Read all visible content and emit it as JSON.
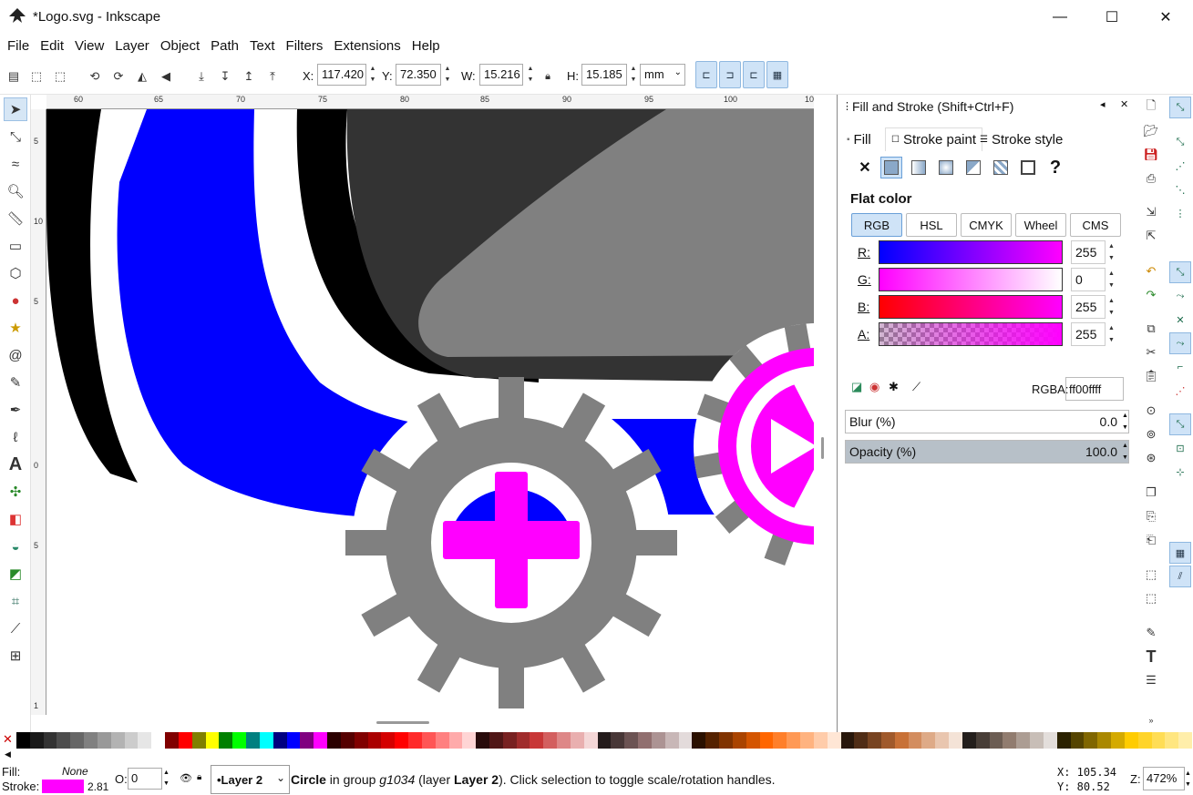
{
  "window": {
    "title": "*Logo.svg - Inkscape",
    "controls": {
      "minimize": "—",
      "maximize": "☐",
      "close": "✕"
    }
  },
  "menu": [
    "File",
    "Edit",
    "View",
    "Layer",
    "Object",
    "Path",
    "Text",
    "Filters",
    "Extensions",
    "Help"
  ],
  "tool_controls": {
    "x_label": "X:",
    "x_value": "117.420",
    "y_label": "Y:",
    "y_value": "72.350",
    "w_label": "W:",
    "w_value": "15.216",
    "h_label": "H:",
    "h_value": "15.185",
    "unit": "mm"
  },
  "ruler": {
    "top_ticks": [
      "60",
      "65",
      "70",
      "75",
      "80",
      "85",
      "90",
      "95",
      "100",
      "10"
    ],
    "left_ticks": [
      "5",
      "10",
      "5",
      "0",
      "5",
      "1"
    ]
  },
  "fill_stroke": {
    "title": "Fill and Stroke (Shift+Ctrl+F)",
    "tabs": [
      "Fill",
      "Stroke paint",
      "Stroke style"
    ],
    "active_tab": "Stroke paint",
    "paint_type": "Flat color",
    "modes": [
      "RGB",
      "HSL",
      "CMYK",
      "Wheel",
      "CMS"
    ],
    "active_mode": "RGB",
    "channels": [
      {
        "label": "R:",
        "value": "255"
      },
      {
        "label": "G:",
        "value": "0"
      },
      {
        "label": "B:",
        "value": "255"
      },
      {
        "label": "A:",
        "value": "255"
      }
    ],
    "rgba_label": "RGBA:",
    "rgba_value": "ff00ffff",
    "blur_label": "Blur (%)",
    "blur_value": "0.0",
    "opacity_label": "Opacity (%)",
    "opacity_value": "100.0"
  },
  "status": {
    "fill_label": "Fill:",
    "fill_value": "None",
    "stroke_label": "Stroke:",
    "stroke_color": "#ff00ff",
    "stroke_width": "2.81",
    "opacity_label": "O:",
    "opacity_value": "0",
    "layer": "•Layer 2",
    "message_bold": "Circle",
    "message_pre": " in group ",
    "message_group": "g1034",
    "message_mid": " (layer ",
    "message_layer": "Layer 2",
    "message_post": "). Click selection to toggle scale/rotation handles.",
    "x_coord": "X: 105.34",
    "y_coord": "Y:  80.52",
    "zoom_label": "Z:",
    "zoom_value": "472%"
  },
  "colors": {
    "magenta": "#ff00ff",
    "blue": "#0000ff",
    "gray": "#808080",
    "dark": "#333333",
    "selection": "#cfe3f7"
  }
}
